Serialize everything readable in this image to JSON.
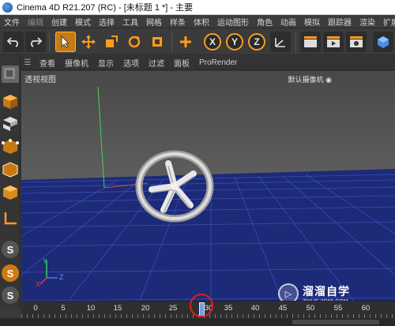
{
  "window": {
    "title": "Cinema 4D R21.207 (RC) - [未标题 1 *] - 主要"
  },
  "menu": {
    "items": [
      "文件",
      "编辑",
      "创建",
      "模式",
      "选择",
      "工具",
      "网格",
      "样条",
      "体积",
      "运动图形",
      "角色",
      "动画",
      "模拟",
      "跟踪器",
      "渲染",
      "扩展"
    ]
  },
  "toolbar": {
    "undo_icon": "undo-icon",
    "redo_icon": "redo-icon",
    "x_label": "X",
    "y_label": "Y",
    "z_label": "Z"
  },
  "view_menu": {
    "items": [
      "查看",
      "摄像机",
      "显示",
      "选项",
      "过滤",
      "面板",
      "ProRender"
    ]
  },
  "viewport": {
    "title": "透视视图",
    "camera": "默认摄像机"
  },
  "axis_gizmo": {
    "x": "X",
    "y": "Y",
    "z": "Z"
  },
  "timeline": {
    "ticks": [
      "0",
      "5",
      "10",
      "15",
      "20",
      "25",
      "30",
      "35",
      "40",
      "45",
      "50",
      "55",
      "60"
    ],
    "current_frame": 30
  },
  "watermark": {
    "title": "溜溜自学",
    "url": "ZIXUE.3D66.COM"
  },
  "colors": {
    "accent_orange": "#ff9c1e",
    "floor_blue": "#1c2a78",
    "y_axis_green": "#3fd35f",
    "playhead_blue": "#6fa0e8"
  }
}
